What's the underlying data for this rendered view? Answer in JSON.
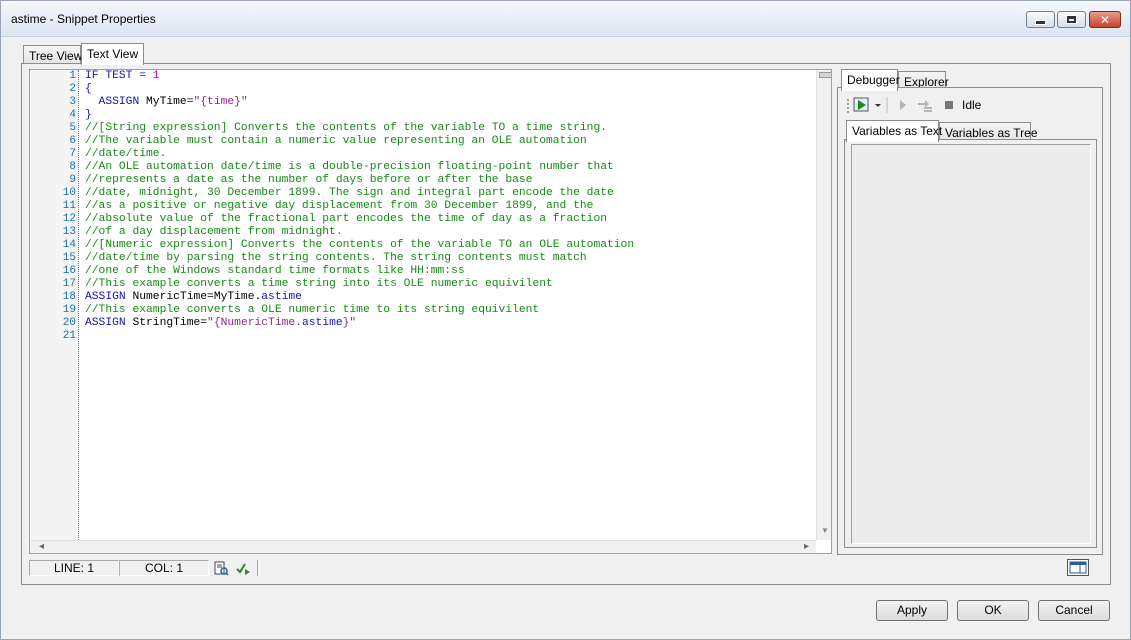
{
  "window": {
    "title": "astime - Snippet Properties"
  },
  "tabs": [
    {
      "label": "Tree View"
    },
    {
      "label": "Text View"
    }
  ],
  "editor": {
    "line_numbers": [
      "1",
      "2",
      "3",
      "4",
      "5",
      "6",
      "7",
      "8",
      "9",
      "10",
      "11",
      "12",
      "13",
      "14",
      "15",
      "16",
      "17",
      "18",
      "19",
      "20",
      "21"
    ],
    "lines": [
      [
        {
          "t": "kw",
          "v": "IF TEST = "
        },
        {
          "t": "num",
          "v": "1"
        }
      ],
      [
        {
          "t": "kw",
          "v": "{"
        }
      ],
      [
        {
          "t": "kw",
          "v": "  ASSIGN "
        },
        {
          "t": "plain",
          "v": "MyTime="
        },
        {
          "t": "str",
          "v": "\"{time}\""
        }
      ],
      [
        {
          "t": "kw",
          "v": "}"
        }
      ],
      [
        {
          "t": "cmt",
          "v": "//[String expression] Converts the contents of the variable TO a time string."
        }
      ],
      [
        {
          "t": "cmt",
          "v": "//The variable must contain a numeric value representing an OLE automation"
        }
      ],
      [
        {
          "t": "cmt",
          "v": "//date/time."
        }
      ],
      [
        {
          "t": "cmt",
          "v": "//An OLE automation date/time is a double-precision floating-point number that"
        }
      ],
      [
        {
          "t": "cmt",
          "v": "//represents a date as the number of days before or after the base"
        }
      ],
      [
        {
          "t": "cmt",
          "v": "//date, midnight, 30 December 1899. The sign and integral part encode the date"
        }
      ],
      [
        {
          "t": "cmt",
          "v": "//as a positive or negative day displacement from 30 December 1899, and the"
        }
      ],
      [
        {
          "t": "cmt",
          "v": "//absolute value of the fractional part encodes the time of day as a fraction"
        }
      ],
      [
        {
          "t": "cmt",
          "v": "//of a day displacement from midnight."
        }
      ],
      [
        {
          "t": "cmt",
          "v": "//[Numeric expression] Converts the contents of the variable TO an OLE automation"
        }
      ],
      [
        {
          "t": "cmt",
          "v": "//date/time by parsing the string contents. The string contents must match"
        }
      ],
      [
        {
          "t": "cmt",
          "v": "//one of the Windows standard time formats like HH:mm:ss"
        }
      ],
      [
        {
          "t": "cmt",
          "v": "//This example converts a time string into its OLE numeric equivilent"
        }
      ],
      [
        {
          "t": "kw",
          "v": "ASSIGN "
        },
        {
          "t": "plain",
          "v": "NumericTime=MyTime."
        },
        {
          "t": "prop",
          "v": "astime"
        }
      ],
      [
        {
          "t": "cmt",
          "v": "//This example converts a OLE numeric time to its string equivilent"
        }
      ],
      [
        {
          "t": "kw",
          "v": "ASSIGN "
        },
        {
          "t": "plain",
          "v": "StringTime="
        },
        {
          "t": "str",
          "v": "\"{NumericTime."
        },
        {
          "t": "prop",
          "v": "astime"
        },
        {
          "t": "str",
          "v": "}\""
        }
      ],
      []
    ]
  },
  "status": {
    "line": "LINE: 1",
    "col": "COL: 1"
  },
  "debugger": {
    "tabs": [
      {
        "label": "Debugger"
      },
      {
        "label": "Explorer"
      }
    ],
    "state": "Idle",
    "sub_tabs": [
      {
        "label": "Variables as Text"
      },
      {
        "label": "Variables as Tree"
      }
    ]
  },
  "buttons": {
    "apply": "Apply",
    "ok": "OK",
    "cancel": "Cancel"
  }
}
